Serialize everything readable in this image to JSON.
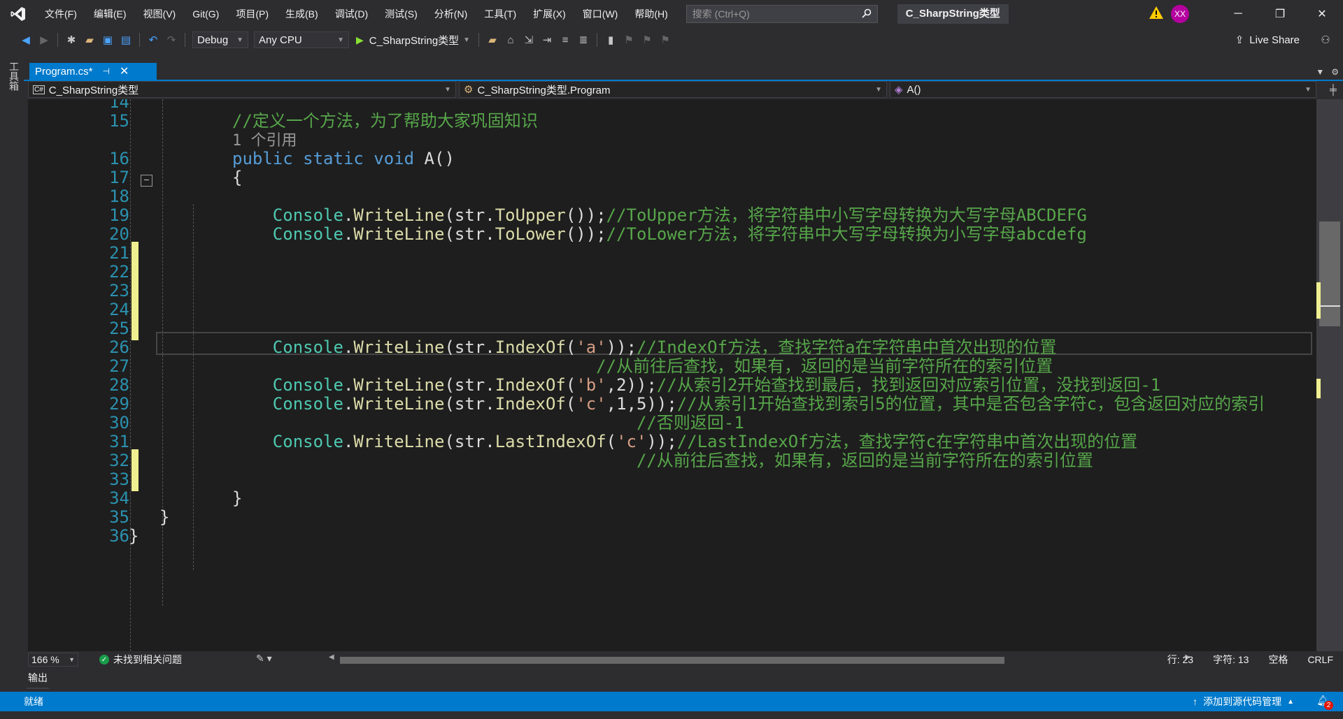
{
  "menu": [
    "文件(F)",
    "编辑(E)",
    "视图(V)",
    "Git(G)",
    "项目(P)",
    "生成(B)",
    "调试(D)",
    "测试(S)",
    "分析(N)",
    "工具(T)",
    "扩展(X)",
    "窗口(W)",
    "帮助(H)"
  ],
  "search": {
    "placeholder": "搜索 (Ctrl+Q)"
  },
  "solution_title": "C_SharpString类型",
  "user_initials": "XX",
  "toolbar": {
    "config": "Debug",
    "platform": "Any CPU",
    "startup": "C_SharpString类型",
    "live_share": "Live Share"
  },
  "toolbox_label": "工具箱",
  "tab": {
    "name": "Program.cs*"
  },
  "nav": {
    "project": "C_SharpString类型",
    "class": "C_SharpString类型.Program",
    "member": "A()"
  },
  "code": [
    {
      "n": "14",
      "parts": []
    },
    {
      "n": "15",
      "parts": [
        {
          "t": "//定义一个方法，为了帮助大家巩固知识",
          "c": "cm"
        }
      ]
    },
    {
      "n": "",
      "parts": [
        {
          "t": "1 个引用",
          "c": "ref"
        }
      ]
    },
    {
      "n": "16",
      "parts": [
        {
          "t": "public static void ",
          "c": "kw"
        },
        {
          "t": "A()",
          "c": ""
        }
      ]
    },
    {
      "n": "17",
      "parts": [
        {
          "t": "{",
          "c": ""
        }
      ]
    },
    {
      "n": "18",
      "parts": []
    },
    {
      "n": "19",
      "parts": [
        {
          "t": "    "
        },
        {
          "t": "Console",
          "c": "cls"
        },
        {
          "t": "."
        },
        {
          "t": "WriteLine",
          "c": "meth"
        },
        {
          "t": "(str."
        },
        {
          "t": "ToUpper",
          "c": "meth"
        },
        {
          "t": "());"
        },
        {
          "t": "//ToUpper方法，将字符串中小写字母转换为大写字母ABCDEFG",
          "c": "cm"
        }
      ]
    },
    {
      "n": "20",
      "parts": [
        {
          "t": "    "
        },
        {
          "t": "Console",
          "c": "cls"
        },
        {
          "t": "."
        },
        {
          "t": "WriteLine",
          "c": "meth"
        },
        {
          "t": "(str."
        },
        {
          "t": "ToLower",
          "c": "meth"
        },
        {
          "t": "());"
        },
        {
          "t": "//ToLower方法，将字符串中大写字母转换为小写字母abcdefg",
          "c": "cm"
        }
      ]
    },
    {
      "n": "21",
      "parts": []
    },
    {
      "n": "22",
      "parts": []
    },
    {
      "n": "23",
      "parts": []
    },
    {
      "n": "24",
      "parts": []
    },
    {
      "n": "25",
      "parts": []
    },
    {
      "n": "26",
      "parts": [
        {
          "t": "    "
        },
        {
          "t": "Console",
          "c": "cls"
        },
        {
          "t": "."
        },
        {
          "t": "WriteLine",
          "c": "meth"
        },
        {
          "t": "(str."
        },
        {
          "t": "IndexOf",
          "c": "meth"
        },
        {
          "t": "("
        },
        {
          "t": "'a'",
          "c": "str"
        },
        {
          "t": "));"
        },
        {
          "t": "//IndexOf方法，查找字符a在字符串中首次出现的位置",
          "c": "cm"
        }
      ]
    },
    {
      "n": "27",
      "parts": [
        {
          "t": "                                    "
        },
        {
          "t": "//从前往后查找，如果有，返回的是当前字符所在的索引位置",
          "c": "cm"
        }
      ]
    },
    {
      "n": "28",
      "parts": [
        {
          "t": "    "
        },
        {
          "t": "Console",
          "c": "cls"
        },
        {
          "t": "."
        },
        {
          "t": "WriteLine",
          "c": "meth"
        },
        {
          "t": "(str."
        },
        {
          "t": "IndexOf",
          "c": "meth"
        },
        {
          "t": "("
        },
        {
          "t": "'b'",
          "c": "str"
        },
        {
          "t": ",2));"
        },
        {
          "t": "//从索引2开始查找到最后，找到返回对应索引位置，没找到返回-1",
          "c": "cm"
        }
      ]
    },
    {
      "n": "29",
      "parts": [
        {
          "t": "    "
        },
        {
          "t": "Console",
          "c": "cls"
        },
        {
          "t": "."
        },
        {
          "t": "WriteLine",
          "c": "meth"
        },
        {
          "t": "(str."
        },
        {
          "t": "IndexOf",
          "c": "meth"
        },
        {
          "t": "("
        },
        {
          "t": "'c'",
          "c": "str"
        },
        {
          "t": ",1,5));"
        },
        {
          "t": "//从索引1开始查找到索引5的位置，其中是否包含字符c，包含返回对应的索引",
          "c": "cm"
        }
      ]
    },
    {
      "n": "30",
      "parts": [
        {
          "t": "                                        "
        },
        {
          "t": "//否则返回-1",
          "c": "cm"
        }
      ]
    },
    {
      "n": "31",
      "parts": [
        {
          "t": "    "
        },
        {
          "t": "Console",
          "c": "cls"
        },
        {
          "t": "."
        },
        {
          "t": "WriteLine",
          "c": "meth"
        },
        {
          "t": "(str."
        },
        {
          "t": "LastIndexOf",
          "c": "meth"
        },
        {
          "t": "("
        },
        {
          "t": "'c'",
          "c": "str"
        },
        {
          "t": "));"
        },
        {
          "t": "//LastIndexOf方法，查找字符c在字符串中首次出现的位置",
          "c": "cm"
        }
      ]
    },
    {
      "n": "32",
      "parts": [
        {
          "t": "                                        "
        },
        {
          "t": "//从前往后查找，如果有，返回的是当前字符所在的索引位置",
          "c": "cm"
        }
      ]
    },
    {
      "n": "33",
      "parts": []
    },
    {
      "n": "34",
      "parts": [
        {
          "t": "}",
          "c": ""
        }
      ]
    },
    {
      "n": "35",
      "parts": [
        {
          "t": "}",
          "c": ""
        }
      ]
    },
    {
      "n": "36",
      "parts": [
        {
          "t": "}",
          "c": ""
        }
      ]
    }
  ],
  "status": {
    "zoom": "166 %",
    "issues": "未找到相关问题",
    "line": "行: 23",
    "col": "字符: 13",
    "ws": "空格",
    "eol": "CRLF"
  },
  "output_label": "输出",
  "bottom": {
    "ready": "就绪",
    "source_control": "添加到源代码管理",
    "notifications": "2"
  }
}
